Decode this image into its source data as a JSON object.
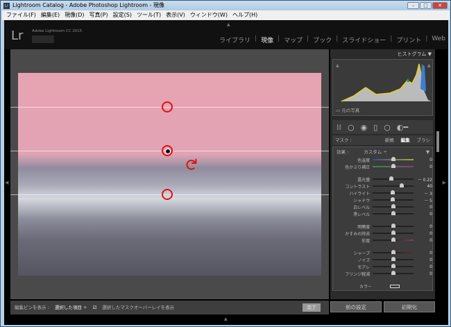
{
  "window": {
    "title": "Lightroom Catalog - Adobe Photoshop Lightroom - 現像",
    "app_icon": "Lr"
  },
  "menu": [
    "ファイル(F)",
    "編集(E)",
    "現像(D)",
    "写真(P)",
    "設定(S)",
    "ツール(T)",
    "表示(V)",
    "ウィンドウ(W)",
    "ヘルプ(H)"
  ],
  "header": {
    "logo": "Lr",
    "product": "Adobe Lightroom CC 2015",
    "modules": [
      "ライブラリ",
      "現像",
      "マップ",
      "ブック",
      "スライドショー",
      "プリント",
      "Web"
    ],
    "active": "現像"
  },
  "histogram": {
    "title": "ヒストグラム",
    "original_photo": "元の写真"
  },
  "mask": {
    "label": "マスク :",
    "new": "新規",
    "edit": "編集",
    "brush": "ブラシ"
  },
  "effect": {
    "label": "効果 :",
    "value": "カスタム ÷"
  },
  "sliders": [
    {
      "label": "色温度",
      "value": "0",
      "pos": 0.5,
      "track": "temp"
    },
    {
      "label": "色かぶり補正",
      "value": "0",
      "pos": 0.5,
      "track": "tint"
    },
    {
      "label": "露光量",
      "value": "－ 0.22",
      "pos": 0.46,
      "gap": true
    },
    {
      "label": "コントラスト",
      "value": "40",
      "pos": 0.7
    },
    {
      "label": "ハイライト",
      "value": "－ 3",
      "pos": 0.49
    },
    {
      "label": "シャドウ",
      "value": "－ 5",
      "pos": 0.48
    },
    {
      "label": "白レベル",
      "value": "0",
      "pos": 0.5
    },
    {
      "label": "黒レベル",
      "value": "0",
      "pos": 0.5
    },
    {
      "label": "明瞭度",
      "value": "0",
      "pos": 0.5,
      "gap": true
    },
    {
      "label": "かすみの除去",
      "value": "0",
      "pos": 0.5
    },
    {
      "label": "彩度",
      "value": "0",
      "pos": 0.5,
      "track": "sat"
    },
    {
      "label": "シャープ",
      "value": "0",
      "pos": 0.5,
      "gap": true,
      "track": "shp"
    },
    {
      "label": "ノイズ",
      "value": "0",
      "pos": 0.5
    },
    {
      "label": "モアレ",
      "value": "0",
      "pos": 0.5
    },
    {
      "label": "フリンジ軽減",
      "value": "0",
      "pos": 0.5
    }
  ],
  "color_label": "カラー",
  "buttons": {
    "previous": "前の設定",
    "reset": "初期化"
  },
  "toolbar": {
    "show_pins": "編集ピンを表示 :",
    "pins_value": "選択した項目 ÷",
    "overlay": "選択したマスクオーバーレイを表示",
    "overlay_checked": true,
    "done": "完了"
  }
}
